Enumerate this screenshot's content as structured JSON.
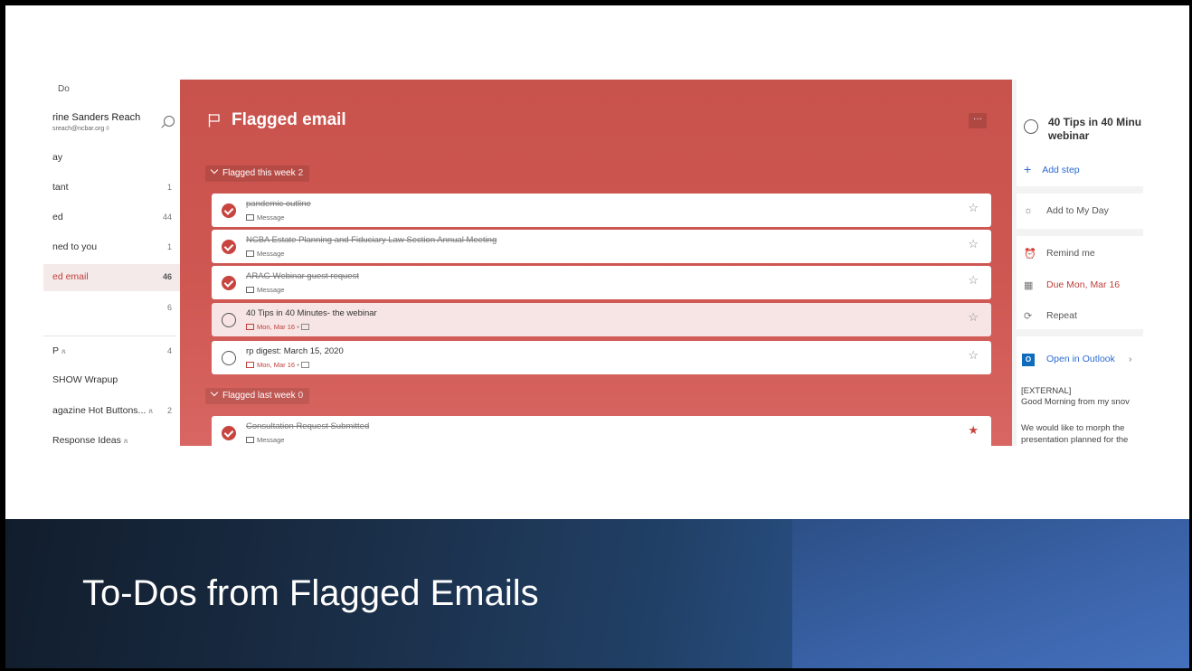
{
  "sidebar": {
    "app_title": "Do",
    "user_name": "rine Sanders Reach",
    "user_email": "sreach@ncbar.org ◊",
    "items": [
      {
        "label": "ay",
        "count": ""
      },
      {
        "label": "tant",
        "count": "1"
      },
      {
        "label": "ed",
        "count": "44"
      },
      {
        "label": "ned to you",
        "count": "1"
      },
      {
        "label": "ed email",
        "count": "46"
      },
      {
        "label": "",
        "count": "6"
      },
      {
        "label": "P",
        "count": "4",
        "shared": "ጸ"
      },
      {
        "label": "SHOW Wrapup",
        "count": ""
      },
      {
        "label": "agazine Hot Buttons...",
        "count": "2",
        "shared": "ጸ"
      },
      {
        "label": "Response Ideas",
        "count": "",
        "shared": "ጸ"
      }
    ]
  },
  "main": {
    "title": "Flagged email",
    "more_label": "···",
    "group_this_week": {
      "label": "Flagged this week",
      "count": "2"
    },
    "group_last_week": {
      "label": "Flagged last week",
      "count": "0"
    },
    "tasks": [
      {
        "title": "pandemic outline",
        "sub": "Message"
      },
      {
        "title": "NCBA Estate Planning and Fiduciary Law Section Annual Meeting",
        "sub": "Message"
      },
      {
        "title": "ARAG Webinar guest request",
        "sub": "Message"
      },
      {
        "title": "40 Tips in 40 Minutes- the webinar",
        "sub": "Mon, Mar 16",
        "sep": "•"
      },
      {
        "title": "rp digest: March 15, 2020",
        "sub": "Mon, Mar 16",
        "sep": "•"
      },
      {
        "title": "Consultation Request Submitted",
        "sub": "Message"
      }
    ]
  },
  "detail": {
    "title": "40 Tips in 40 Minu webinar",
    "add_step": "Add step",
    "add_my_day": "Add to My Day",
    "remind": "Remind me",
    "due": "Due Mon, Mar 16",
    "repeat": "Repeat",
    "open_outlook": "Open in Outlook",
    "body_lines": [
      "[EXTERNAL]",
      "Good Morning from my snov",
      "We would like to morph the",
      "presentation planned for the"
    ]
  },
  "slide": {
    "title": "To-Dos from Flagged Emails"
  }
}
